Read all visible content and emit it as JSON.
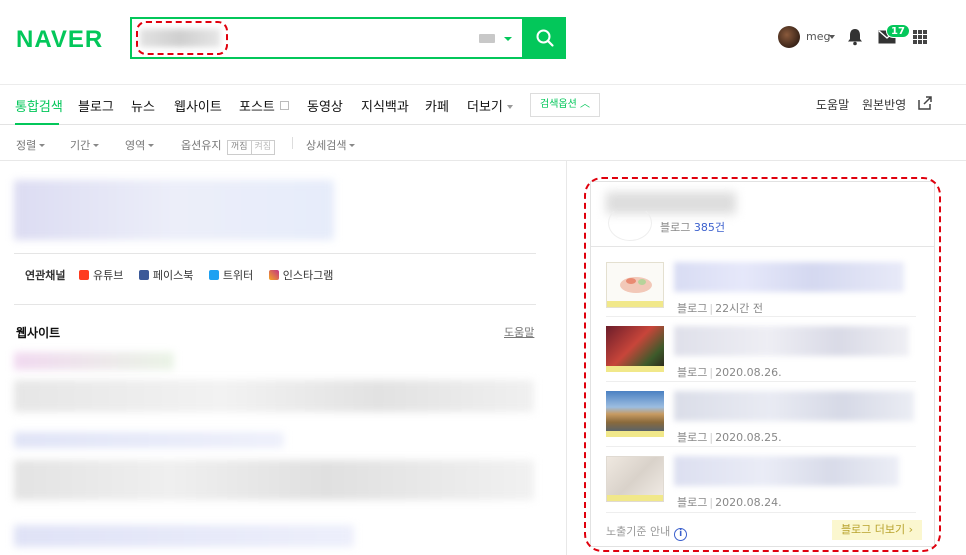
{
  "header": {
    "logo": "NAVER",
    "profile_name": "meg",
    "mail_count": "17"
  },
  "tabs": [
    {
      "label": "통합검색",
      "active": true
    },
    {
      "label": "블로그"
    },
    {
      "label": "뉴스"
    },
    {
      "label": "웹사이트"
    },
    {
      "label": "포스트"
    },
    {
      "label": "동영상"
    },
    {
      "label": "지식백과"
    },
    {
      "label": "카페"
    },
    {
      "label": "더보기"
    }
  ],
  "search_options_label": "검색옵션",
  "tabs_right": {
    "help": "도움말",
    "original": "원본반영"
  },
  "filters": {
    "sort": "정렬",
    "period": "기간",
    "area": "영역",
    "keep_option": "옵션유지",
    "on": "꺼짐",
    "off": "켜짐",
    "detail": "상세검색"
  },
  "channels": {
    "label": "연관채널",
    "items": [
      {
        "name": "유튜브",
        "color": "#ff3b1f"
      },
      {
        "name": "페이스북",
        "color": "#3b5998"
      },
      {
        "name": "트위터",
        "color": "#1da1f2"
      },
      {
        "name": "인스타그램",
        "color": "#c13584"
      }
    ]
  },
  "website_section": {
    "title": "웹사이트",
    "help": "도움말"
  },
  "blog_panel": {
    "count_prefix": "블로그",
    "count": "385건",
    "items": [
      {
        "source": "블로그",
        "date": "22시간 전"
      },
      {
        "source": "블로그",
        "date": "2020.08.26."
      },
      {
        "source": "블로그",
        "date": "2020.08.25."
      },
      {
        "source": "블로그",
        "date": "2020.08.24."
      }
    ],
    "footer_note": "노출기준 안내",
    "more_button": "블로그 더보기"
  },
  "colors": {
    "brand": "#03c75a",
    "highlight_outline": "#e0000d"
  }
}
